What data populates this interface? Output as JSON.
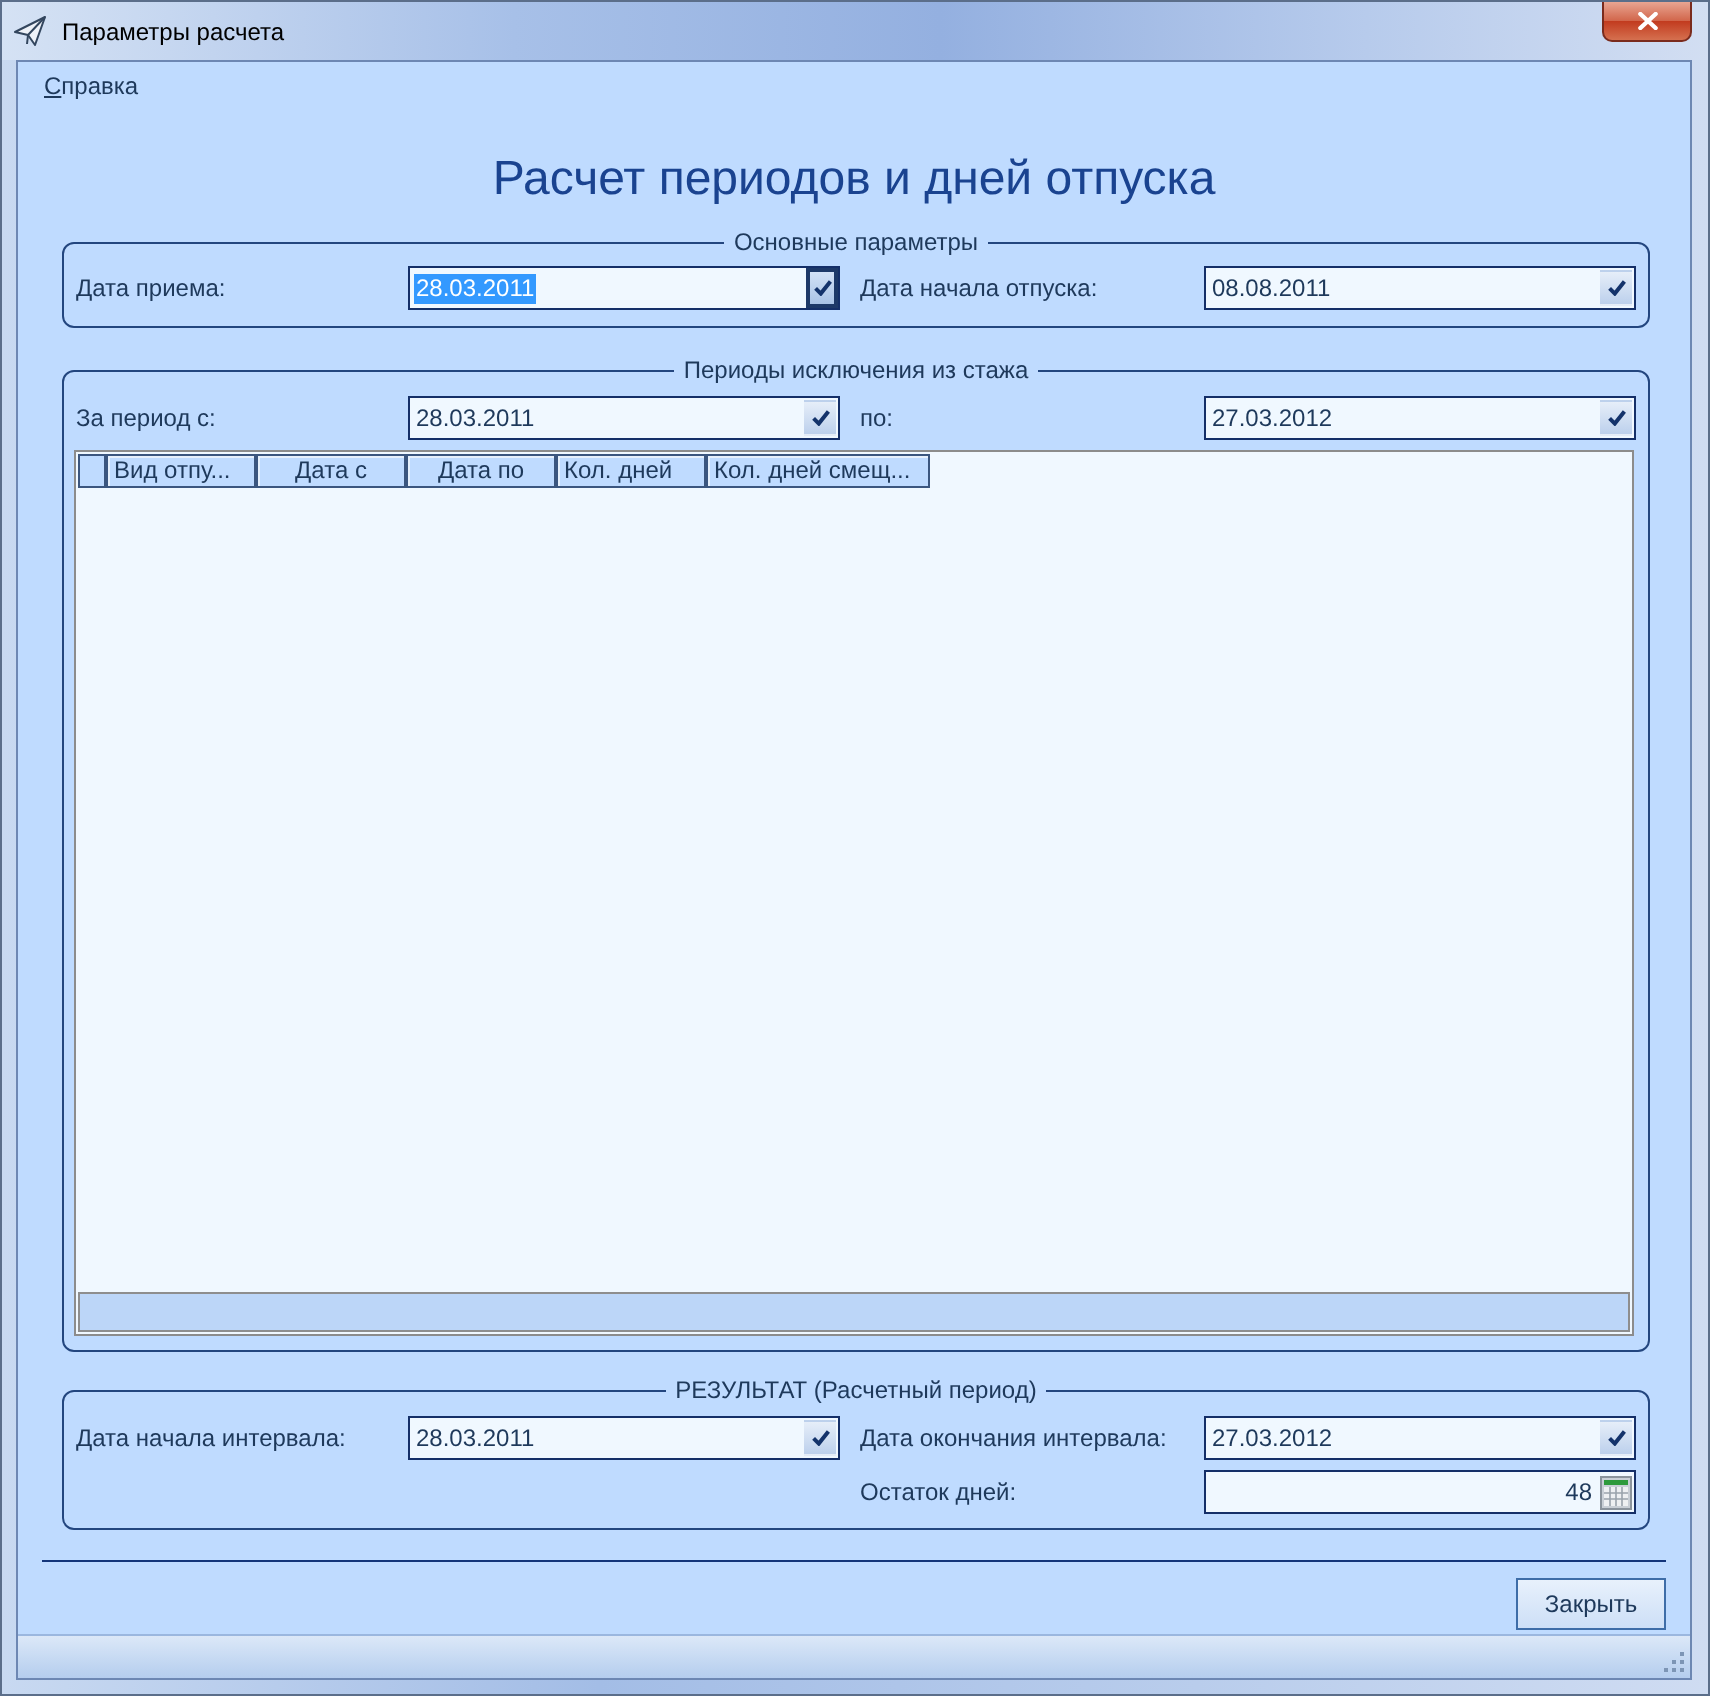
{
  "window": {
    "title": "Параметры расчета"
  },
  "menu": {
    "help_link": "Справка"
  },
  "heading": "Расчет периодов и дней отпуска",
  "groups": [
    {
      "title": "Основные параметры",
      "rows": [
        {
          "left": {
            "label": "Дата приема:",
            "kind": "date",
            "value": "28.03.2011",
            "focused": true
          },
          "right": {
            "label": "Дата начала отпуска:",
            "kind": "date",
            "value": "08.08.2011",
            "focused": false
          }
        }
      ]
    },
    {
      "title": "Периоды исключения из стажа",
      "rows": [
        {
          "left": {
            "label": "За период с:",
            "kind": "date",
            "value": "28.03.2011",
            "focused": false
          },
          "right": {
            "label": "по:",
            "kind": "date",
            "value": "27.03.2012",
            "focused": false
          }
        }
      ],
      "table": {
        "columns": [
          "Вид отпу...",
          "Дата с",
          "Дата по",
          "Кол. дней",
          "Кол. дней смещ..."
        ]
      }
    },
    {
      "title": "РЕЗУЛЬТАТ (Расчетный период)",
      "rows": [
        {
          "left": {
            "label": "Дата начала интервала:",
            "kind": "date",
            "value": "28.03.2011",
            "focused": false
          },
          "right": {
            "label": "Дата окончания интервала:",
            "kind": "date",
            "value": "27.03.2012",
            "focused": false
          }
        },
        {
          "right": {
            "label": "Остаток дней:",
            "kind": "number",
            "value": "48",
            "focused": false
          }
        }
      ]
    }
  ],
  "buttons": [
    {
      "label": "Закрыть"
    }
  ]
}
